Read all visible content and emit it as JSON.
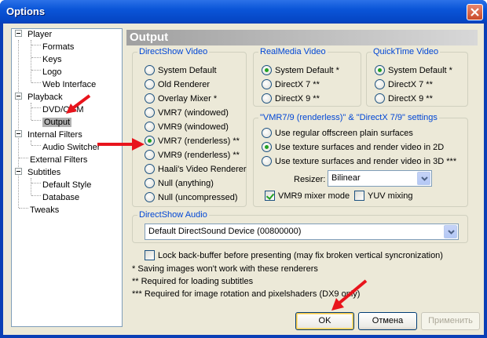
{
  "window": {
    "title": "Options"
  },
  "tree": {
    "items": [
      {
        "label": "Player"
      },
      {
        "label": "Formats"
      },
      {
        "label": "Keys"
      },
      {
        "label": "Logo"
      },
      {
        "label": "Web Interface"
      },
      {
        "label": "Playback"
      },
      {
        "label": "DVD/OGM"
      },
      {
        "label": "Output"
      },
      {
        "label": "Internal Filters"
      },
      {
        "label": "Audio Switcher"
      },
      {
        "label": "External Filters"
      },
      {
        "label": "Subtitles"
      },
      {
        "label": "Default Style"
      },
      {
        "label": "Database"
      },
      {
        "label": "Tweaks"
      }
    ]
  },
  "panel": {
    "title": "Output"
  },
  "directshow_video": {
    "legend": "DirectShow Video",
    "options": [
      {
        "label": "System Default",
        "selected": false
      },
      {
        "label": "Old Renderer",
        "selected": false
      },
      {
        "label": "Overlay Mixer *",
        "selected": false
      },
      {
        "label": "VMR7 (windowed)",
        "selected": false
      },
      {
        "label": "VMR9 (windowed)",
        "selected": false
      },
      {
        "label": "VMR7 (renderless) **",
        "selected": true
      },
      {
        "label": "VMR9 (renderless) **",
        "selected": false
      },
      {
        "label": "Haali's Video Renderer",
        "selected": false
      },
      {
        "label": "Null (anything)",
        "selected": false
      },
      {
        "label": "Null (uncompressed)",
        "selected": false
      }
    ]
  },
  "realmedia_video": {
    "legend": "RealMedia Video",
    "options": [
      {
        "label": "System Default *",
        "selected": true
      },
      {
        "label": "DirectX 7 **",
        "selected": false
      },
      {
        "label": "DirectX 9 **",
        "selected": false
      }
    ]
  },
  "quicktime_video": {
    "legend": "QuickTime Video",
    "options": [
      {
        "label": "System Default *",
        "selected": true
      },
      {
        "label": "DirectX 7 **",
        "selected": false
      },
      {
        "label": "DirectX 9 **",
        "selected": false
      }
    ]
  },
  "vmr_settings": {
    "legend": "\"VMR7/9 (renderless)\" & \"DirectX 7/9\" settings",
    "options": [
      {
        "label": "Use regular offscreen plain surfaces",
        "selected": false
      },
      {
        "label": "Use texture surfaces and render video in 2D",
        "selected": true
      },
      {
        "label": "Use texture surfaces and render video in 3D ***",
        "selected": false
      }
    ],
    "resizer_label": "Resizer:",
    "resizer_value": "Bilinear",
    "vmr9_mixer_label": "VMR9 mixer mode",
    "yuv_mixing_label": "YUV mixing"
  },
  "directshow_audio": {
    "legend": "DirectShow Audio",
    "device": "Default DirectSound Device (00800000)"
  },
  "lock_backbuffer_label": "Lock back-buffer before presenting (may fix broken vertical syncronization)",
  "notes": [
    "* Saving images won't work with these renderers",
    "** Required for loading subtitles",
    "*** Required for image rotation and pixelshaders (DX9 only)"
  ],
  "buttons": {
    "ok": "OK",
    "cancel": "Отмена",
    "apply": "Применить"
  }
}
